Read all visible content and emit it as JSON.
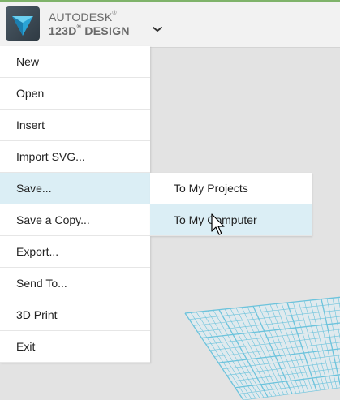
{
  "app": {
    "brand_line1": "AUTODESK",
    "brand_line2": "123D",
    "brand_line2_suffix": "DESIGN",
    "registered_mark": "®",
    "accent_color": "#7fb36a",
    "logo_icon": "autodesk-123d-logo-icon",
    "menu_toggle_icon": "chevron-down-icon"
  },
  "file_menu": {
    "items": [
      {
        "label": "New"
      },
      {
        "label": "Open"
      },
      {
        "label": "Insert"
      },
      {
        "label": "Import SVG..."
      },
      {
        "label": "Save...",
        "active": true
      },
      {
        "label": "Save a Copy..."
      },
      {
        "label": "Export..."
      },
      {
        "label": "Send To..."
      },
      {
        "label": "3D Print"
      },
      {
        "label": "Exit"
      }
    ],
    "highlight_color": "#dbeef5"
  },
  "save_submenu": {
    "items": [
      {
        "label": "To My Projects"
      },
      {
        "label": "To My Computer",
        "hovered": true
      }
    ]
  },
  "workspace": {
    "grid_color": "#6cc3dc",
    "background_color": "#e3e3e3"
  }
}
